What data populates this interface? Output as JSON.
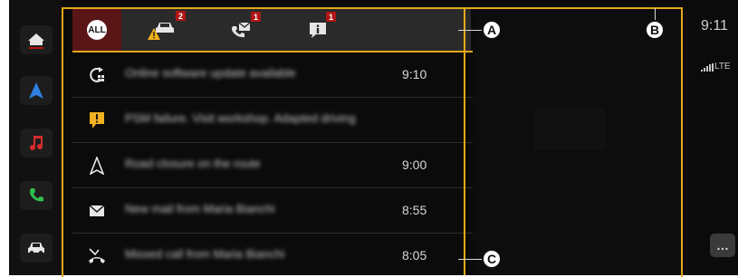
{
  "tabs": {
    "all_label": "ALL",
    "car_badge": "2",
    "phone_badge": "1",
    "info_badge": "1"
  },
  "notifications": [
    {
      "icon": "software-update-icon",
      "text": "Online software update available",
      "time": "9:10"
    },
    {
      "icon": "alert-icon",
      "text": "PSM failure. Visit workshop. Adapted driving",
      "time": ""
    },
    {
      "icon": "navigation-icon",
      "text": "Road closure on the route",
      "time": "9:00"
    },
    {
      "icon": "mail-icon",
      "text": "New mail from Maria Bianchi",
      "time": "8:55"
    },
    {
      "icon": "missed-call-icon",
      "text": "Missed call from Maria Bianchi",
      "time": "8:05"
    }
  ],
  "status": {
    "clock": "9:11",
    "network": "LTE",
    "more_label": "…"
  },
  "callouts": {
    "a": "A",
    "b": "B",
    "c": "C"
  },
  "colors": {
    "frame": "#e2a81b",
    "badge": "#b01515",
    "all_tab_bg": "#5a1616",
    "home_line": "#b01515",
    "nav_blue": "#2f7fe0",
    "music_red": "#d82b2b",
    "phone_green": "#2fbf4f"
  }
}
